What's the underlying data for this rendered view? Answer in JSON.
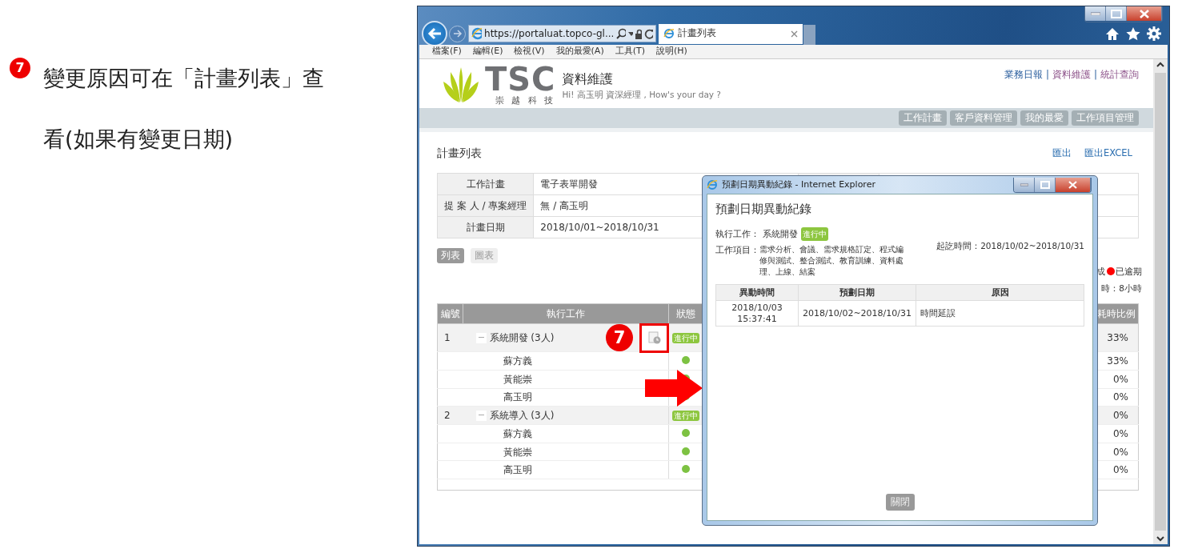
{
  "slide": {
    "step": "7",
    "note": "變更原因可在「計畫列表」查看(如果有變更日期)"
  },
  "browser": {
    "address": "https://portaluat.topco-gl...",
    "tabs": [
      {
        "title": "計畫列表",
        "selected": true
      }
    ],
    "menu": [
      "檔案(F)",
      "編輯(E)",
      "檢視(V)",
      "我的最愛(A)",
      "工具(T)",
      "說明(H)"
    ]
  },
  "page": {
    "brand": {
      "logo": "TSC",
      "subtitle": "崇 越 科 技",
      "app": "資料維護",
      "greeting": "Hi! 高玉明 資深經理 , How's your day ?"
    },
    "top_links": [
      {
        "kind": "link",
        "label": "業務日報",
        "visited": false
      },
      {
        "kind": "separator",
        "label": "|"
      },
      {
        "kind": "link",
        "label": "資料維護",
        "visited": true
      },
      {
        "kind": "separator",
        "label": "|"
      },
      {
        "kind": "link",
        "label": "統計查詢",
        "visited": true
      }
    ],
    "nav_buttons": [
      "工作計畫",
      "客戶資料管理",
      "我的最愛",
      "工作項目管理"
    ],
    "title": "計畫列表",
    "export_links": [
      "匯出",
      "匯出EXCEL"
    ],
    "info": [
      {
        "label": "工作計畫",
        "value": "電子表單開發"
      },
      {
        "label": "提 案 人 / 專案經理",
        "value": "無 / 高玉明"
      },
      {
        "label": "計畫日期",
        "value": "2018/10/01~2018/10/31"
      }
    ],
    "views": [
      {
        "label": "列表",
        "selected": true
      },
      {
        "label": "圖表",
        "selected": false
      }
    ],
    "legend": [
      {
        "label": "成"
      },
      {
        "label": "已逾期",
        "color": "#ff0000"
      }
    ],
    "total_hours": "時：8小時",
    "table": {
      "columns": [
        "編號",
        "執行工作",
        "狀態",
        "耗時比例"
      ],
      "groups": [
        {
          "no": "1",
          "name": "系統開發 (3人)",
          "expanded": true,
          "history": true,
          "callout": "7",
          "status": "進行中",
          "ratio": "33%",
          "members": [
            {
              "name": "蘇方義",
              "ratio": "33%"
            },
            {
              "name": "黃能崇",
              "ratio": "0%"
            },
            {
              "name": "高玉明",
              "ratio": "0%"
            }
          ]
        },
        {
          "no": "2",
          "name": "系統導入 (3人)",
          "expanded": true,
          "history": false,
          "status": "進行中",
          "ratio": "0%",
          "members": [
            {
              "name": "蘇方義",
              "ratio": "0%"
            },
            {
              "name": "黃能崇",
              "ratio": "0%"
            },
            {
              "name": "高玉明",
              "ratio": "0%"
            }
          ]
        }
      ]
    }
  },
  "popup": {
    "window_title": "預劃日期異動紀錄 - Internet Explorer",
    "heading": "預劃日期異動紀錄",
    "task_label": "執行工作：",
    "task": "系統開發",
    "status": "進行中",
    "period": "起訖時間：2018/10/02~2018/10/31",
    "items_label": "工作項目：",
    "items": "需求分析、會議、需求規格訂定、程式編修與測試、整合測試、教育訓練、資料處理、上線、結案",
    "columns": [
      "異動時間",
      "預劃日期",
      "原因"
    ],
    "rows": [
      {
        "time": "2018/10/03 15:37:41",
        "planned": "2018/10/02~2018/10/31",
        "reason": "時間延誤"
      }
    ],
    "close_button": "關閉"
  }
}
